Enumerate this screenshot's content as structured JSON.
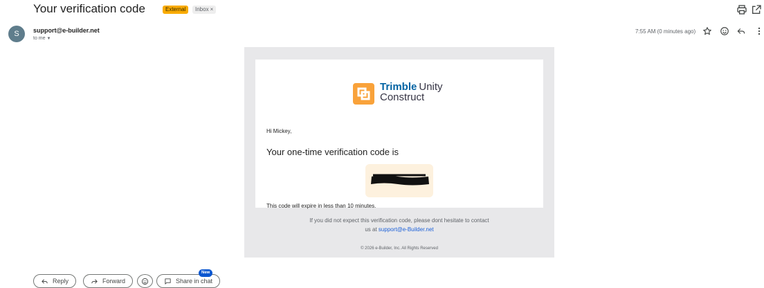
{
  "email": {
    "subject": "Your verification code",
    "labels": {
      "external": "External",
      "inbox": "Inbox",
      "inbox_remove": "×"
    },
    "sender": "support@e-builder.net",
    "recipient": "to me",
    "avatar_letter": "S",
    "timestamp": "7:55 AM (0 minutes ago)"
  },
  "body": {
    "brand_bold": "Trimble",
    "brand_rest": "Unity",
    "brand_line2": "Construct",
    "greeting": "Hi Mickey,",
    "code_intro": "Your one-time verification code is",
    "expire_note": "This code will expire in less than 10 minutes.",
    "footer_line1": "If you did not expect this verification code, please dont hesitate to contact",
    "footer_line2_prefix": "us at ",
    "footer_link": "support@e-Builder.net",
    "copyright": "© 2026 e-Builder, Inc. All Rights Reserved"
  },
  "actions": {
    "reply": "Reply",
    "forward": "Forward",
    "share": "Share in chat",
    "new_badge": "New"
  },
  "colors": {
    "accent": "#0b57d0",
    "external_label": "#f9ab00",
    "logo": "#f9a23a",
    "brand_blue": "#0063a3"
  },
  "icons": [
    "print-icon",
    "open-new-window-icon",
    "star-icon",
    "emoji-icon",
    "reply-icon",
    "more-vert-icon",
    "forward-icon",
    "chat-icon",
    "chevron-down-icon"
  ]
}
